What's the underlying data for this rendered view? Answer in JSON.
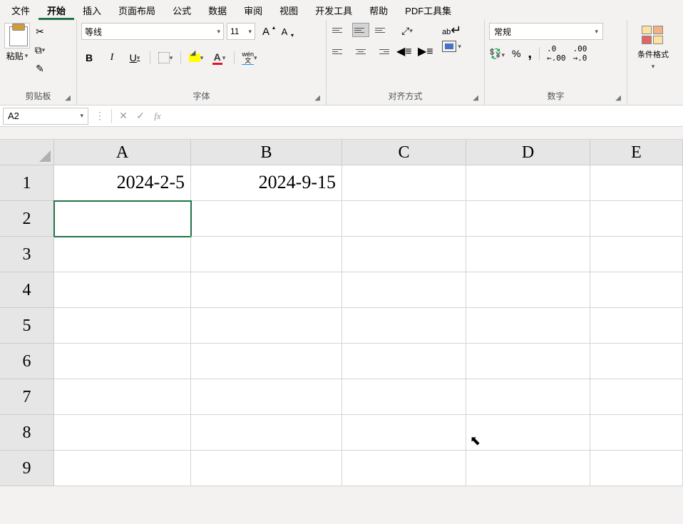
{
  "menu": {
    "items": [
      "文件",
      "开始",
      "插入",
      "页面布局",
      "公式",
      "数据",
      "审阅",
      "视图",
      "开发工具",
      "帮助",
      "PDF工具集"
    ],
    "active": "开始"
  },
  "ribbon": {
    "clipboard": {
      "paste": "粘贴",
      "label": "剪贴板"
    },
    "font": {
      "name": "等线",
      "size": "11",
      "bold": "B",
      "italic": "I",
      "underline": "U",
      "fontcolor_letter": "A",
      "pinyin_top": "wén",
      "pinyin_bottom": "文",
      "label": "字体"
    },
    "align": {
      "wrap": "ab",
      "label": "对齐方式"
    },
    "number": {
      "format": "常规",
      "percent": "%",
      "comma": ",",
      "dec_inc": ".00\n→.0",
      "dec_dec": ".0\n→.00",
      "label": "数字"
    },
    "condfmt": {
      "label": "条件格式"
    }
  },
  "formula_bar": {
    "name_box": "A2",
    "cancel": "✕",
    "enter": "✓",
    "fx": "fx",
    "value": ""
  },
  "grid": {
    "columns": [
      "A",
      "B",
      "C",
      "D",
      "E"
    ],
    "rows": [
      "1",
      "2",
      "3",
      "4",
      "5",
      "6",
      "7",
      "8",
      "9"
    ],
    "cells": {
      "A1": "2024-2-5",
      "B1": "2024-9-15"
    },
    "selected": "A2"
  }
}
